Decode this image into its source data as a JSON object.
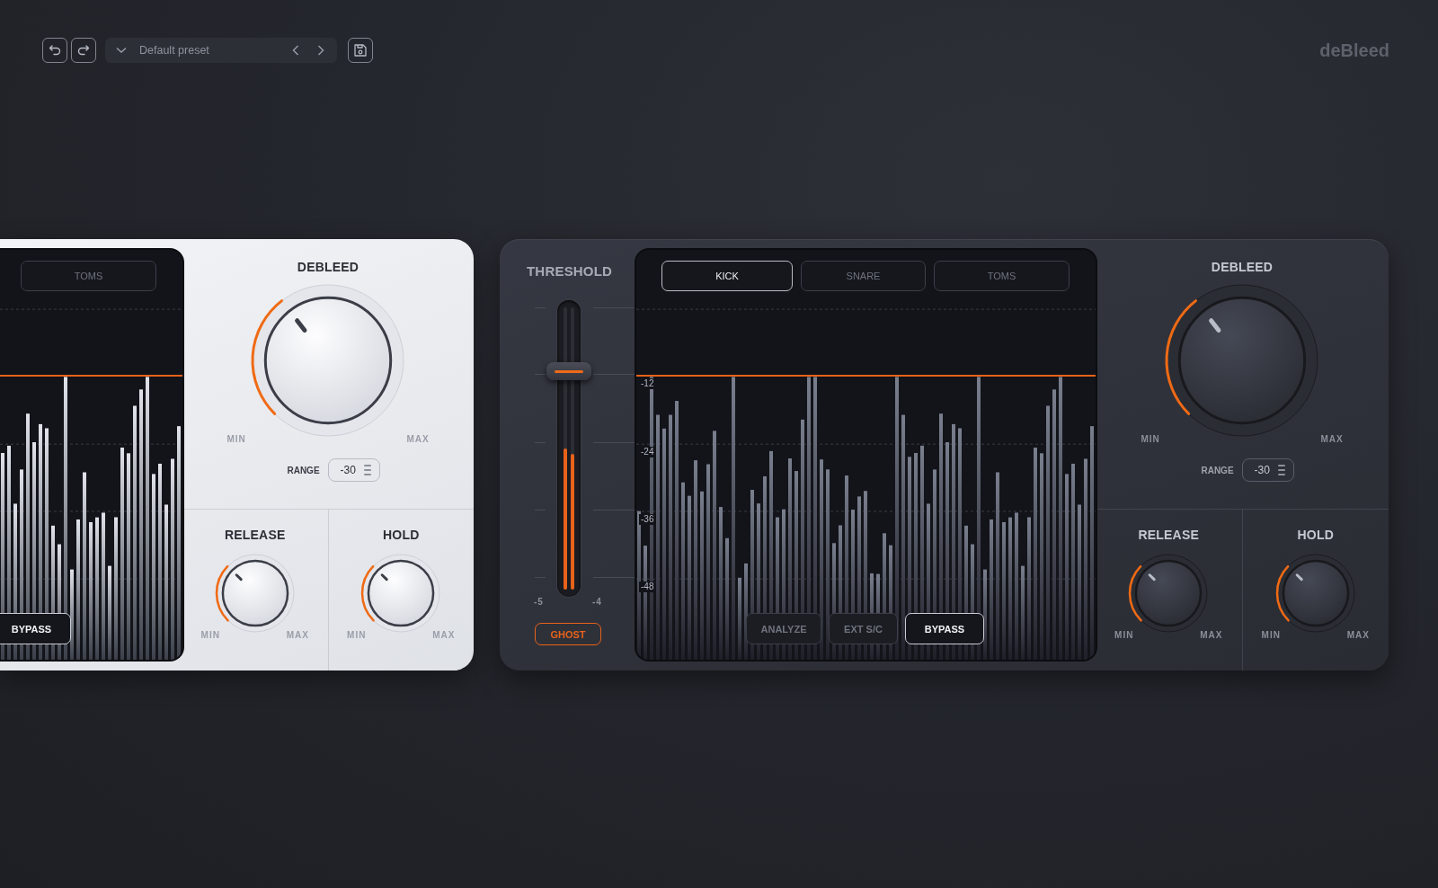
{
  "toolbar": {
    "preset": "Default preset"
  },
  "logo": "deBleed",
  "panels": [
    {
      "kind": "light",
      "spectrum": {
        "tabs": [
          {
            "label": "TOMS",
            "selected": false
          }
        ],
        "buttons": [
          {
            "label": "BYPASS",
            "on": true
          }
        ]
      },
      "controls": {
        "main": {
          "title": "DEBLEED",
          "min_label": "MIN",
          "max_label": "MAX"
        },
        "range": {
          "label": "RANGE",
          "value": "-30"
        },
        "knobs": [
          {
            "title": "RELEASE",
            "min_label": "MIN",
            "max_label": "MAX"
          },
          {
            "title": "HOLD",
            "min_label": "MIN",
            "max_label": "MAX"
          }
        ]
      }
    },
    {
      "kind": "dark",
      "threshold": {
        "title": "THRESHOLD",
        "meters": [
          {
            "level": 0.5
          },
          {
            "level": 0.48
          }
        ],
        "meter_readings": [
          "-5",
          "-4"
        ],
        "ghost": {
          "label": "GHOST",
          "on": true
        }
      },
      "spectrum": {
        "tabs": [
          {
            "label": "KICK",
            "selected": true
          },
          {
            "label": "SNARE",
            "selected": false
          },
          {
            "label": "TOMS",
            "selected": false
          }
        ],
        "scale_labels": [
          "-12",
          "-24",
          "-36",
          "-48"
        ],
        "buttons": [
          {
            "label": "ANALYZE",
            "on": false
          },
          {
            "label": "EXT S/C",
            "on": false
          },
          {
            "label": "BYPASS",
            "on": true
          }
        ]
      },
      "controls": {
        "main": {
          "title": "DEBLEED",
          "min_label": "MIN",
          "max_label": "MAX"
        },
        "range": {
          "label": "RANGE",
          "value": "-30"
        },
        "knobs": [
          {
            "title": "RELEASE",
            "min_label": "MIN",
            "max_label": "MAX"
          },
          {
            "title": "HOLD",
            "min_label": "MIN",
            "max_label": "MAX"
          }
        ]
      }
    }
  ]
}
